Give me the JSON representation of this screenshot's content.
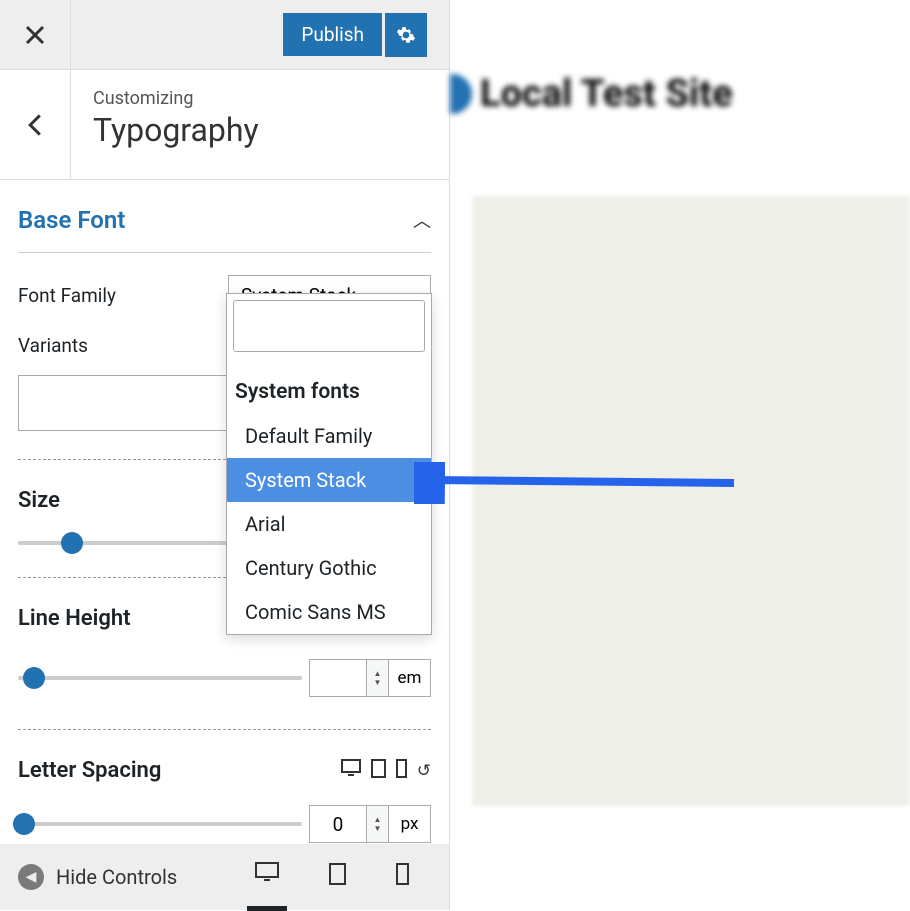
{
  "header": {
    "publish_label": "Publish"
  },
  "section": {
    "customizing_label": "Customizing",
    "title": "Typography"
  },
  "accordion": {
    "title": "Base Font"
  },
  "fontFamily": {
    "label": "Font Family",
    "selected": "System Stack"
  },
  "variants": {
    "label": "Variants"
  },
  "dropdown": {
    "group_label": "System fonts",
    "items": [
      "Default Family",
      "System Stack",
      "Arial",
      "Century Gothic",
      "Comic Sans MS"
    ],
    "selected_index": 1
  },
  "size": {
    "label": "Size"
  },
  "lineHeight": {
    "label": "Line Height",
    "unit": "em"
  },
  "letterSpacing": {
    "label": "Letter Spacing",
    "value": "0",
    "unit": "px"
  },
  "footer": {
    "hide_label": "Hide Controls"
  },
  "preview": {
    "site_title": "Local Test Site"
  }
}
